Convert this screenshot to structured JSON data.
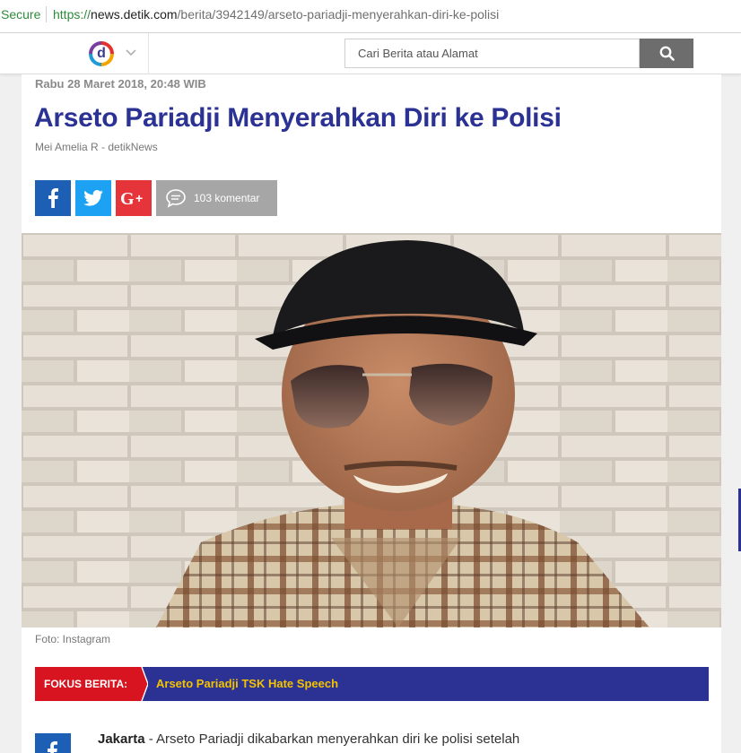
{
  "browser": {
    "secure_label": "Secure",
    "url_scheme": "https://",
    "url_host": "news.detik.com",
    "url_path": "/berita/3942149/arseto-pariadji-menyerahkan-diri-ke-polisi"
  },
  "header": {
    "logo_letter": "d",
    "search_placeholder": "Cari Berita atau Alamat"
  },
  "article": {
    "date": "Rabu 28 Maret 2018, 20:48 WIB",
    "title": "Arseto Pariadji Menyerahkan Diri ke Polisi",
    "byline": "Mei Amelia R - detikNews",
    "comments": "103 komentar",
    "photo_caption": "Foto: Instagram",
    "focus_label": "FOKUS BERITA:",
    "focus_topic": "Arseto Pariadji TSK Hate Speech",
    "lead_place": "Jakarta",
    "lead_text": " - Arseto Pariadji dikabarkan menyerahkan diri ke polisi setelah"
  },
  "colors": {
    "title": "#2b3294",
    "facebook": "#1d5fb5",
    "twitter": "#1da1f2",
    "googleplus": "#e5353a",
    "focus_red": "#d7141f",
    "focus_yellow": "#f3c300"
  },
  "icons": [
    "chevron-down-icon",
    "search-icon",
    "facebook-icon",
    "twitter-icon",
    "google-plus-icon",
    "comment-icon"
  ]
}
